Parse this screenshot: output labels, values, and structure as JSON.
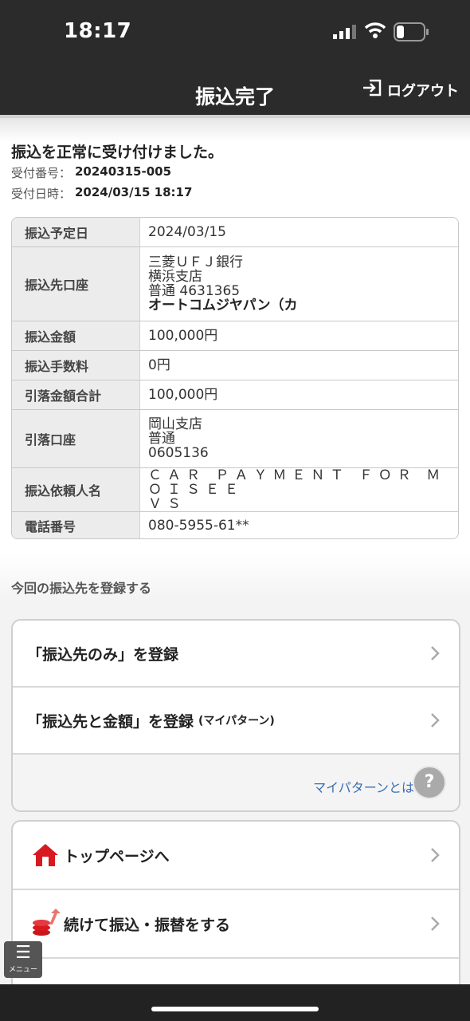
{
  "status_bar": {
    "time": "18:17"
  },
  "nav": {
    "title": "振込完了",
    "logout_label": "ログアウト"
  },
  "result": {
    "message": "振込を正常に受け付けました。",
    "receipt_no_label": "受付番号：",
    "receipt_no": "20240315-005",
    "receipt_dt_label": "受付日時：",
    "receipt_dt": "2024/03/15 18:17"
  },
  "details": {
    "scheduled_date": {
      "label": "振込予定日",
      "value": "2024/03/15"
    },
    "dest_account": {
      "label": "振込先口座",
      "bank": "三菱ＵＦＪ銀行",
      "branch": "横浜支店",
      "account": "普通 4631365",
      "holder": "オートコムジヤパン（カ"
    },
    "amount": {
      "label": "振込金額",
      "value": "100,000円"
    },
    "fee": {
      "label": "振込手数料",
      "value": "0円"
    },
    "total": {
      "label": "引落金額合計",
      "value": "100,000円"
    },
    "debit_account": {
      "label": "引落口座",
      "branch": "岡山支店",
      "type": "普通",
      "number": "0605136"
    },
    "requester": {
      "label": "振込依頼人名",
      "line1": "ＣＡＲ ＰＡＹＭＥＮＴ ＦＯＲ ＭＯＩＳＥＥ",
      "line2": "ＶＳ"
    },
    "phone": {
      "label": "電話番号",
      "value": "080-5955-61**"
    }
  },
  "register": {
    "title": "今回の振込先を登録する",
    "dest_only": "「振込先のみ」を登録",
    "dest_amount": "「振込先と金額」を登録",
    "dest_amount_note": "(マイパターン)",
    "mypattern_link": "マイパターンとは",
    "help": "?"
  },
  "nav_links": {
    "top_page": "トップページへ",
    "continue": "続けて振込・振替をする"
  },
  "menu": {
    "label": "メニュー"
  },
  "colors": {
    "header_bg": "#2b2b2b",
    "link": "#3b6fb0",
    "home_icon": "#d71920"
  }
}
